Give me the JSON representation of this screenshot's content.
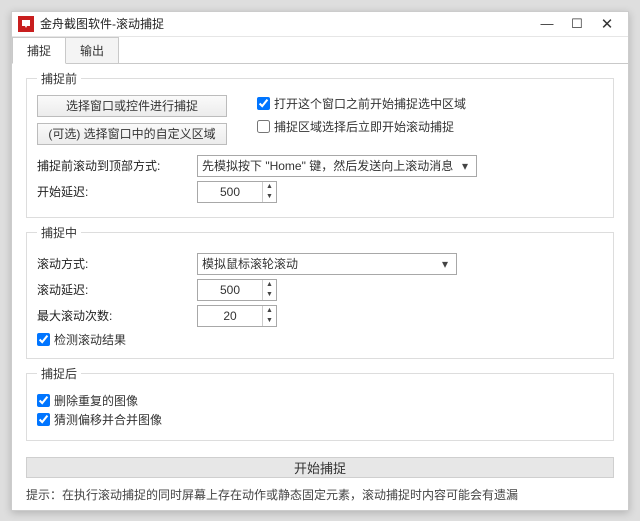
{
  "window": {
    "title": "金舟截图软件-滚动捕捉"
  },
  "tabs": {
    "capture": "捕捉",
    "output": "输出"
  },
  "before": {
    "legend": "捕捉前",
    "btn_select_window": "选择窗口或控件进行捕捉",
    "btn_select_custom": "(可选) 选择窗口中的自定义区域",
    "cb_open_before": "打开这个窗口之前开始捕捉选中区域",
    "cb_start_after_select": "捕捉区域选择后立即开始滚动捕捉",
    "scroll_top_label": "捕捉前滚动到顶部方式:",
    "scroll_top_value": "先模拟按下 \"Home\" 键，然后发送向上滚动消息",
    "start_delay_label": "开始延迟:",
    "start_delay_value": "500"
  },
  "during": {
    "legend": "捕捉中",
    "scroll_method_label": "滚动方式:",
    "scroll_method_value": "模拟鼠标滚轮滚动",
    "scroll_delay_label": "滚动延迟:",
    "scroll_delay_value": "500",
    "max_scroll_label": "最大滚动次数:",
    "max_scroll_value": "20",
    "cb_detect_end": "检测滚动结果"
  },
  "after": {
    "legend": "捕捉后",
    "cb_remove_dup": "删除重复的图像",
    "cb_stitch": "猜测偏移并合并图像"
  },
  "start_button": "开始捕捉",
  "hint_prefix": "提示：",
  "hint_text": "在执行滚动捕捉的同时屏幕上存在动作或静态固定元素，滚动捕捉时内容可能会有遗漏"
}
